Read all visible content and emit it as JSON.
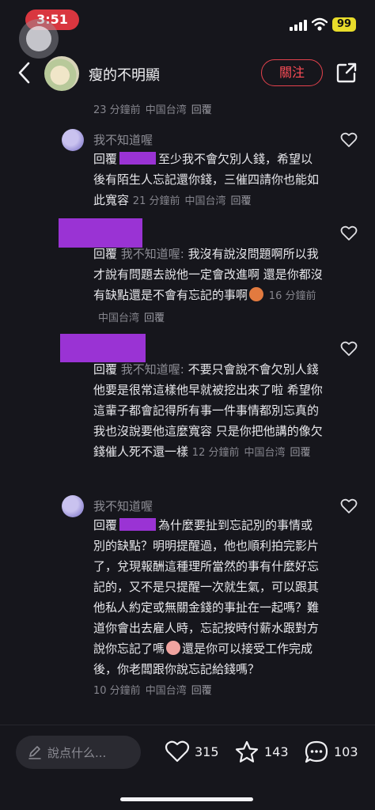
{
  "status_bar": {
    "time": "3:51",
    "battery": "99"
  },
  "header": {
    "user_name": "瘦的不明顯",
    "follow_label": "關注"
  },
  "top_meta": {
    "time": "23 分鐘前",
    "location": "中国台湾",
    "reply": "回覆"
  },
  "comments": [
    {
      "name": "我不知道喔",
      "prefix": "回覆",
      "text": "至少我不會欠別人錢，希望以後有陌生人忘記還你錢，三催四請你也能如此寬容",
      "time": "21 分鐘前",
      "location": "中国台湾",
      "reply": "回覆"
    },
    {
      "prefix": "回覆",
      "mention": "我不知道喔:",
      "text": "我沒有說沒問題啊所以我才說有問題去說他一定會改進啊 還是你都沒有缺點還是不會有忘記的事啊",
      "time": "16 分鐘前",
      "location": "中国台湾",
      "reply": "回覆"
    },
    {
      "prefix": "回覆",
      "mention": "我不知道喔:",
      "text": "不要只會說不會欠別人錢 他要是很常這樣他早就被挖出來了啦 希望你這輩子都會記得所有事一件事情都別忘真的 我也沒說要他這麼寬容 只是你把他講的像欠錢催人死不還一樣",
      "time": "12 分鐘前",
      "location": "中国台湾",
      "reply": "回覆"
    },
    {
      "name": "我不知道喔",
      "prefix": "回覆",
      "text_a": "為什麼要扯到忘記別的事情或別的缺點？明明提醒過，他也順利拍完影片了，兌現報酬這種理所當然的事有什麼好忘記的，又不是只提醒一次就生氣，可以跟其他私人約定或無關金錢的事扯在一起嗎？難道你會出去雇人時，忘記按時付薪水跟對方說你忘記了嗎",
      "text_b": "還是你可以接受工作完成後，你老闆跟你說忘記給錢嗎？",
      "time": "10 分鐘前",
      "location": "中国台湾",
      "reply": "回覆"
    }
  ],
  "bottom_bar": {
    "compose_placeholder": "說点什么...",
    "likes": "315",
    "stars": "143",
    "comments": "103"
  },
  "colors": {
    "accent_red": "#ff4d57",
    "redaction": "#9a33d4",
    "background": "#16161c"
  },
  "icons": [
    "back-icon",
    "share-icon",
    "heart-icon",
    "star-icon",
    "comment-icon",
    "pen-icon"
  ]
}
